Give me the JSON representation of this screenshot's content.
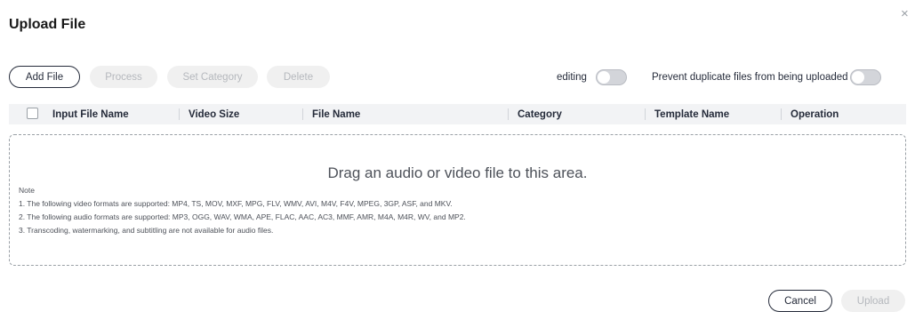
{
  "dialog": {
    "title": "Upload File",
    "close_icon": "×"
  },
  "toolbar": {
    "add_file": "Add File",
    "process": "Process",
    "set_category": "Set Category",
    "delete": "Delete"
  },
  "toggles": {
    "editing": {
      "label": "editing",
      "on": false
    },
    "prevent_duplicates": {
      "label": "Prevent duplicate files from being uploaded",
      "on": false
    }
  },
  "table": {
    "columns": [
      "Input File Name",
      "Video Size",
      "File Name",
      "Category",
      "Template Name",
      "Operation"
    ]
  },
  "dropzone": {
    "prompt": "Drag an audio or video file to this area.",
    "note_title": "Note",
    "notes": [
      "1. The following video formats are supported: MP4, TS, MOV, MXF, MPG, FLV, WMV, AVI, M4V, F4V, MPEG, 3GP, ASF, and MKV.",
      "2. The following audio formats are supported: MP3, OGG, WAV, WMA, APE, FLAC, AAC, AC3, MMF, AMR, M4A, M4R, WV, and MP2.",
      "3. Transcoding, watermarking, and subtitling are not available for audio files."
    ]
  },
  "footer": {
    "cancel": "Cancel",
    "upload": "Upload"
  },
  "colors": {
    "text": "#252b3a",
    "disabled_bg": "#f0f0f0",
    "disabled_text": "#b5b8bd",
    "header_bg": "#f2f3f5"
  }
}
